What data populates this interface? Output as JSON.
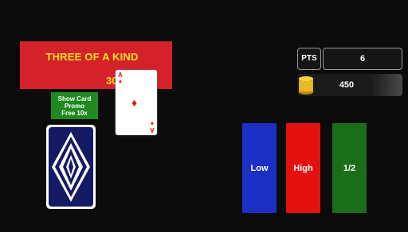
{
  "banner": {
    "title": "THREE OF A KIND",
    "amount": "30",
    "color": "#d4212a",
    "text_color": "#ffe21a"
  },
  "promo": {
    "line1": "Show Card",
    "line2": "Promo",
    "line3": "Free 10x"
  },
  "revealed_card": {
    "rank": "A",
    "suit_symbol": "♦",
    "suit_color": "#e01818"
  },
  "stats": {
    "pts_label": "PTS",
    "pts_value": "6",
    "coins_value": "450",
    "coin_icon": "coin-stack-icon"
  },
  "buttons": {
    "low": "Low",
    "high": "High",
    "half": "1/2"
  },
  "colors": {
    "low": "#1b2fc4",
    "high": "#e4120f",
    "half": "#1a6e1a",
    "background": "#0b0b0b"
  }
}
